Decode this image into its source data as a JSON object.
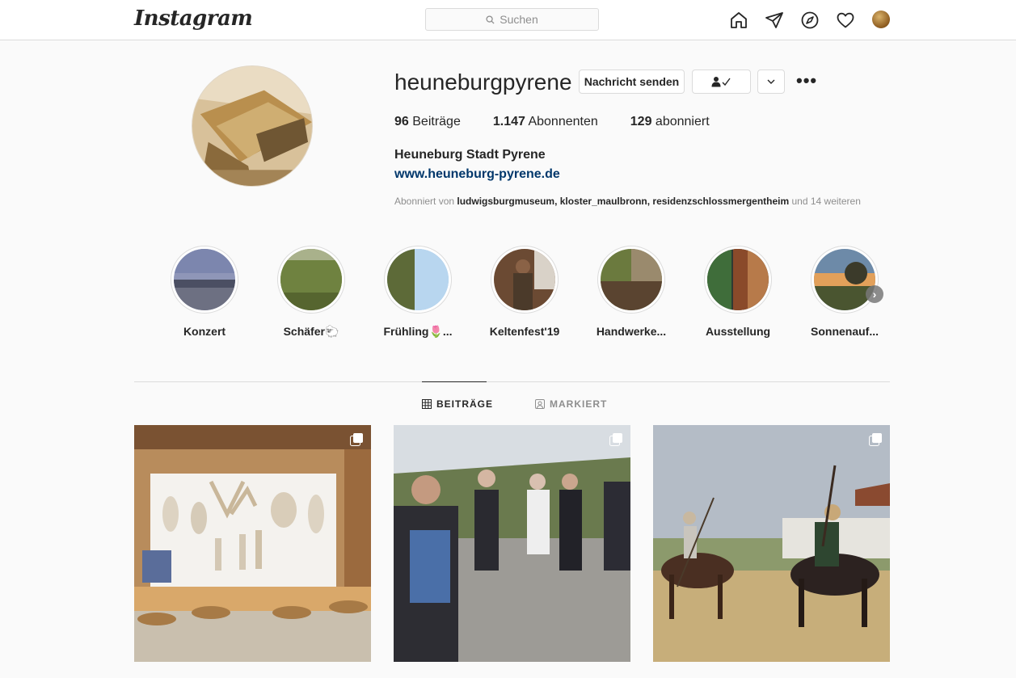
{
  "nav": {
    "logo": "Instagram",
    "search_placeholder": "Suchen",
    "icons": [
      "home-icon",
      "direct-icon",
      "explore-icon",
      "activity-heart-icon",
      "profile-avatar"
    ]
  },
  "profile": {
    "username": "heuneburgpyrene",
    "message_button": "Nachricht senden",
    "stats": {
      "posts_count": "96",
      "posts_label": "Beiträge",
      "followers_count": "1.147",
      "followers_label": "Abonnenten",
      "following_count": "129",
      "following_label": "abonniert"
    },
    "full_name": "Heuneburg Stadt Pyrene",
    "website": "www.heuneburg-pyrene.de",
    "followed_by_prefix": "Abonniert von ",
    "followed_by_accounts": "ludwigsburgmuseum, kloster_maulbronn, residenzschlossmergentheim",
    "followed_by_suffix": " und 14 weiteren"
  },
  "highlights": [
    {
      "label": "Konzert"
    },
    {
      "label": "Schäfer🐑"
    },
    {
      "label": "Frühling🌷..."
    },
    {
      "label": "Keltenfest'19"
    },
    {
      "label": "Handwerke..."
    },
    {
      "label": "Ausstellung"
    },
    {
      "label": "Sonnenauf..."
    }
  ],
  "tabs": {
    "posts": "BEITRÄGE",
    "tagged": "MARKIERT"
  },
  "colors": {
    "link": "#00376b",
    "border": "#dbdbdb",
    "muted": "#8e8e8e",
    "text": "#262626"
  }
}
